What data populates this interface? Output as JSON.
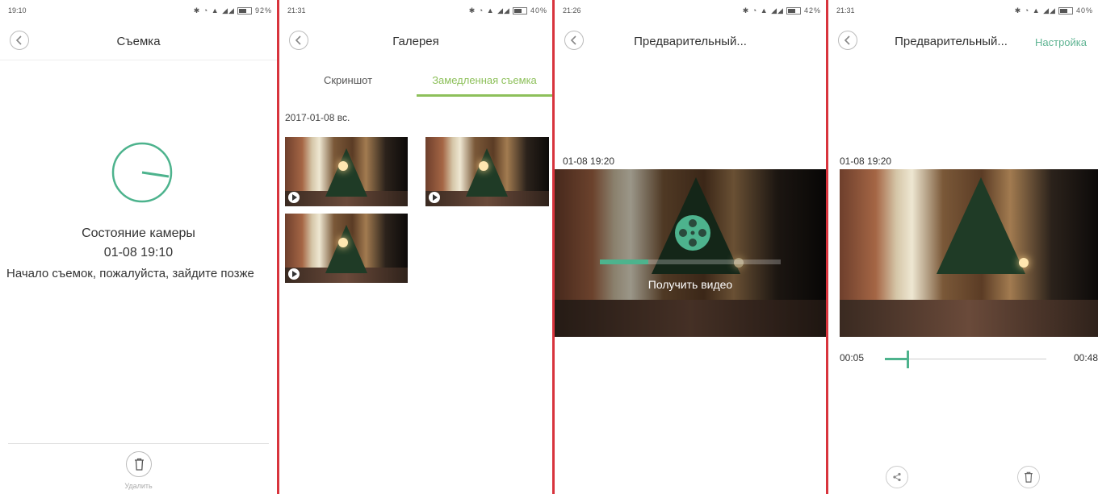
{
  "accent": "#5fb493",
  "divider_color": "#d8343d",
  "panels": [
    {
      "status": {
        "time": "19:10",
        "battery": "92%"
      },
      "header": {
        "title": "Съемка"
      },
      "camera": {
        "title": "Состояние камеры",
        "datetime": "01-08 19:10",
        "message": "Начало съемок, пожалуйста, зайдите позже"
      },
      "footer": {
        "delete_label": "Удалить"
      }
    },
    {
      "status": {
        "time": "21:31",
        "battery": "40%"
      },
      "header": {
        "title": "Галерея"
      },
      "tabs": [
        {
          "label": "Скриншот",
          "active": false
        },
        {
          "label": "Замедленная съемка",
          "active": true
        }
      ],
      "date_group": "2017-01-08 вс."
    },
    {
      "status": {
        "time": "21:26",
        "battery": "42%"
      },
      "header": {
        "title": "Предварительный..."
      },
      "timestamp": "01-08 19:20",
      "loading": {
        "label": "Получить видео",
        "progress": 0.27
      }
    },
    {
      "status": {
        "time": "21:31",
        "battery": "40%"
      },
      "header": {
        "title": "Предварительный...",
        "action": "Настройка"
      },
      "timestamp": "01-08 19:20",
      "player": {
        "current": "00:05",
        "total": "00:48",
        "progress": 0.14
      }
    }
  ]
}
